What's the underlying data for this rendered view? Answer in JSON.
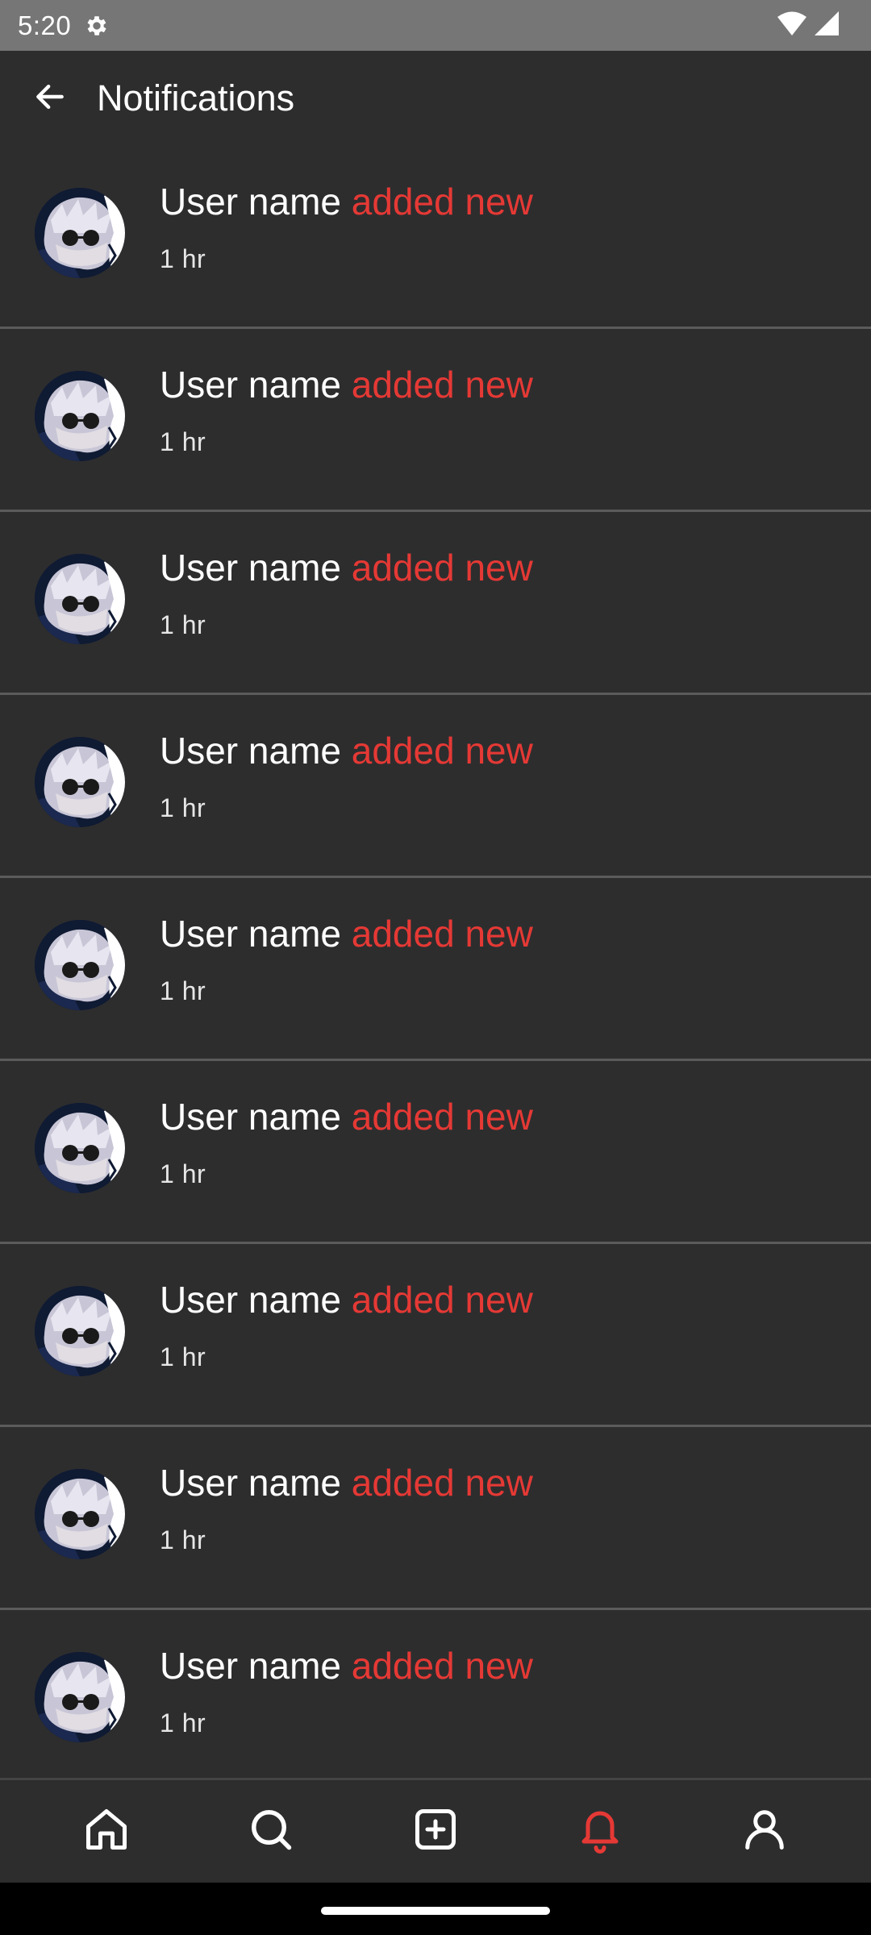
{
  "status_bar": {
    "time": "5:20",
    "icons": [
      "gear-icon",
      "wifi-icon",
      "cell-signal-icon"
    ]
  },
  "header": {
    "title": "Notifications",
    "back_icon": "arrow-left-icon"
  },
  "notifications": [
    {
      "user": "User name",
      "action": "added new",
      "time": "1 hr"
    },
    {
      "user": "User name",
      "action": "added new",
      "time": "1 hr"
    },
    {
      "user": "User name",
      "action": "added new",
      "time": "1 hr"
    },
    {
      "user": "User name",
      "action": "added new",
      "time": "1 hr"
    },
    {
      "user": "User name",
      "action": "added new",
      "time": "1 hr"
    },
    {
      "user": "User name",
      "action": "added new",
      "time": "1 hr"
    },
    {
      "user": "User name",
      "action": "added new",
      "time": "1 hr"
    },
    {
      "user": "User name",
      "action": "added new",
      "time": "1 hr"
    },
    {
      "user": "User name",
      "action": "added new",
      "time": "1 hr"
    }
  ],
  "bottom_nav": {
    "items": [
      "home-icon",
      "search-icon",
      "add-post-icon",
      "bell-icon",
      "profile-icon"
    ],
    "active": "bell-icon"
  },
  "colors": {
    "background": "#2d2d2e",
    "accent": "#e53935",
    "divider": "#5b5b5c",
    "status_bar": "#767676"
  }
}
